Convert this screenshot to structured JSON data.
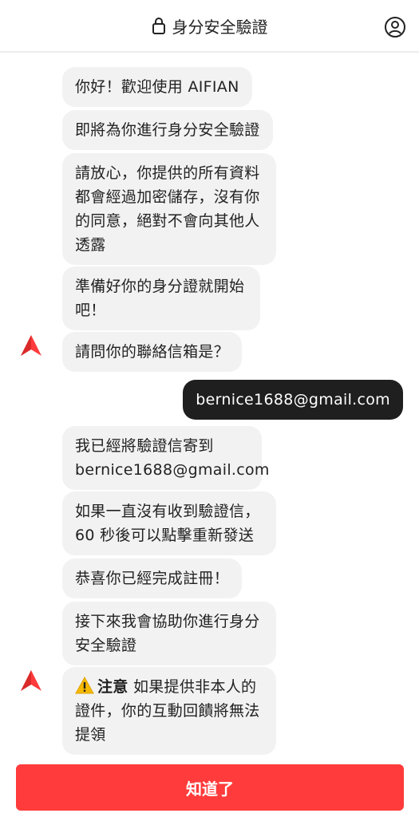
{
  "header": {
    "title": "身分安全驗證",
    "left_icon": "lock-icon",
    "right_icon": "profile-icon"
  },
  "messages": [
    {
      "from": "bot",
      "text": "你好！歡迎使用 AIFIAN"
    },
    {
      "from": "bot",
      "text": "即將為你進行身分安全驗證"
    },
    {
      "from": "bot",
      "text": "請放心，你提供的所有資料都會經過加密儲存，沒有你的同意，絕對不會向其他人透露"
    },
    {
      "from": "bot",
      "text": "準備好你的身分證就開始吧！"
    },
    {
      "from": "bot",
      "text": "請問你的聯絡信箱是？"
    },
    {
      "from": "user",
      "text": "bernice1688@gmail.com"
    },
    {
      "from": "bot",
      "text": "我已經將驗證信寄到 bernice1688@gmail.com"
    },
    {
      "from": "bot",
      "text": "如果一直沒有收到驗證信，60 秒後可以點擊重新發送"
    },
    {
      "from": "bot",
      "text": "恭喜你已經完成註冊！"
    },
    {
      "from": "bot",
      "text": "接下來我會協助你進行身分安全驗證"
    },
    {
      "from": "bot",
      "warning_label": "注意",
      "text": "如果提供非本人的證件，你的互動回饋將無法提領"
    }
  ],
  "bot_avatar_icon": "aifian-logo-icon",
  "warning_icon": "warning-icon",
  "footer": {
    "button_label": "知道了"
  },
  "colors": {
    "accent": "#ff3b3b",
    "user_bubble": "#1f1f1f",
    "bot_bubble": "#f2f2f2"
  }
}
